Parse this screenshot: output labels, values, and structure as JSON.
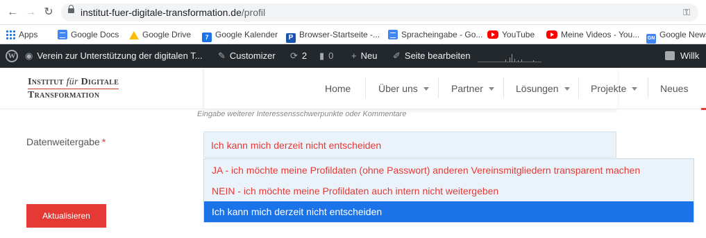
{
  "browser": {
    "url_host": "institut-fuer-digitale-transformation.de",
    "url_path": "/profil"
  },
  "bookmarks": [
    {
      "label": "Apps",
      "icon": "apps-grid-icon"
    },
    {
      "label": "Google Docs",
      "icon": "google-docs-icon"
    },
    {
      "label": "Google Drive",
      "icon": "google-drive-icon"
    },
    {
      "label": "Google Kalender",
      "icon": "google-calendar-icon"
    },
    {
      "label": "Browser-Startseite -...",
      "icon": "p-icon"
    },
    {
      "label": "Spracheingabe - Go...",
      "icon": "google-docs-icon"
    },
    {
      "label": "YouTube",
      "icon": "youtube-icon"
    },
    {
      "label": "Meine Videos - You...",
      "icon": "youtube-icon"
    },
    {
      "label": "Google News",
      "icon": "google-news-icon"
    }
  ],
  "adminbar": {
    "site_name": "Verein zur Unterstützung der digitalen T...",
    "customizer": "Customizer",
    "updates_count": "2",
    "comments_count": "0",
    "new_label": "Neu",
    "edit_label": "Seite bearbeiten",
    "greeting": "Willk"
  },
  "header": {
    "logo_line1_a": "Institut ",
    "logo_line1_b": "für",
    "logo_line1_c": " Digitale",
    "logo_line2": "Transformation",
    "nav": [
      {
        "label": "Home",
        "has_caret": false
      },
      {
        "label": "Über uns",
        "has_caret": true
      },
      {
        "label": "Partner",
        "has_caret": true
      },
      {
        "label": "Lösungen",
        "has_caret": true
      },
      {
        "label": "Projekte",
        "has_caret": true
      },
      {
        "label": "Neues",
        "has_caret": false
      }
    ]
  },
  "form": {
    "hint": "Eingabe weiterer Interessensschwerpunkte oder Kommentare",
    "field_label": "Datenweitergabe",
    "required_marker": "*",
    "selected_value": "Ich kann mich derzeit nicht entscheiden",
    "options": [
      "JA - ich möchte meine Profildaten (ohne Passwort) anderen Vereinsmitgliedern transparent machen",
      "NEIN - ich möchte meine Profildaten auch intern nicht weitergeben",
      "Ich kann mich derzeit nicht entscheiden"
    ],
    "highlighted_option_index": 2,
    "submit_label": "Aktualisieren"
  },
  "colors": {
    "accent_red": "#e53935",
    "select_bg": "#eaf3fa",
    "highlight_blue": "#1a73e8",
    "adminbar_bg": "#23282d"
  }
}
